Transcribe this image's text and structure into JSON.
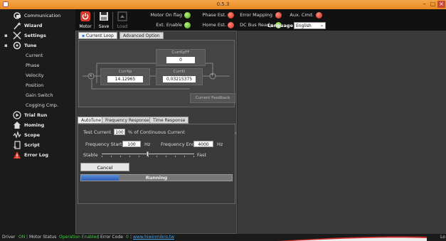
{
  "window": {
    "title": "0.5.3"
  },
  "sidebar": {
    "items": [
      {
        "label": "Communication",
        "icon": "communication-icon"
      },
      {
        "label": "Wizard",
        "icon": "wizard-icon"
      },
      {
        "label": "Settings",
        "icon": "settings-icon"
      },
      {
        "label": "Tune",
        "icon": "tune-icon"
      },
      {
        "label": "Current"
      },
      {
        "label": "Phase"
      },
      {
        "label": "Velocity"
      },
      {
        "label": "Position"
      },
      {
        "label": "Gain Switch"
      },
      {
        "label": "Cogging Cmp."
      },
      {
        "label": "Trial Run",
        "icon": "play-icon"
      },
      {
        "label": "Homing",
        "icon": "home-icon"
      },
      {
        "label": "Scope",
        "icon": "scope-icon"
      },
      {
        "label": "Script",
        "icon": "script-icon"
      },
      {
        "label": "Error Log",
        "icon": "warning-icon"
      }
    ]
  },
  "toolbar": {
    "motor_label": "Motor",
    "save_label": "Save",
    "load_label": "Load",
    "motor_on_flag": "Motor On flag",
    "ext_enable": "Ext. Enable",
    "phase_est": "Phase Est.",
    "home_est": "Home Est.",
    "error_mapping": "Error Mapping",
    "dc_bus_ready": "DC Bus Ready",
    "aux_cmd": "Aux. Cmd.",
    "language_label": "Language",
    "language_value": "English"
  },
  "tabs": {
    "current_loop": "Current Loop",
    "advanced_option": "Advanced Option"
  },
  "diagram": {
    "kp_label": "CurrKp",
    "kp_value": "14.12965",
    "ki_label": "CurrKi",
    "ki_value": "0.03215375",
    "kpff_label": "CurrKpFF",
    "kpff_value": "0",
    "feedback_label": "Current Feedback",
    "mult_symbol": "×",
    "sum_symbol": "+"
  },
  "lower_tabs": {
    "autotune": "AutoTune",
    "freq_response": "Frequency Response",
    "time_response": "Time Response"
  },
  "autotune": {
    "test_current_label": "Test Current",
    "test_current_value": "100",
    "test_current_unit": "% of Continuous Current",
    "freq_start_label": "Frequency Start",
    "freq_start_value": "100",
    "freq_start_unit": "Hz",
    "freq_end_label": "Frequency End",
    "freq_end_value": "4000",
    "freq_end_unit": "Hz",
    "stable_label": "Stable",
    "fast_label": "Fast",
    "slider_level": 0.5,
    "cancel_label": "Cancel",
    "progress_text": "Running",
    "progress_fraction": 0.25
  },
  "statusbar": {
    "driver_label": "Driver",
    "driver_value": "ON",
    "motor_status_label": "Motor Status",
    "motor_status_value": "Operation Enabled",
    "error_code_label": "Error Code",
    "error_code_value": "0",
    "link": "www.hiwinmikro.tw",
    "right_text": "Lo"
  }
}
